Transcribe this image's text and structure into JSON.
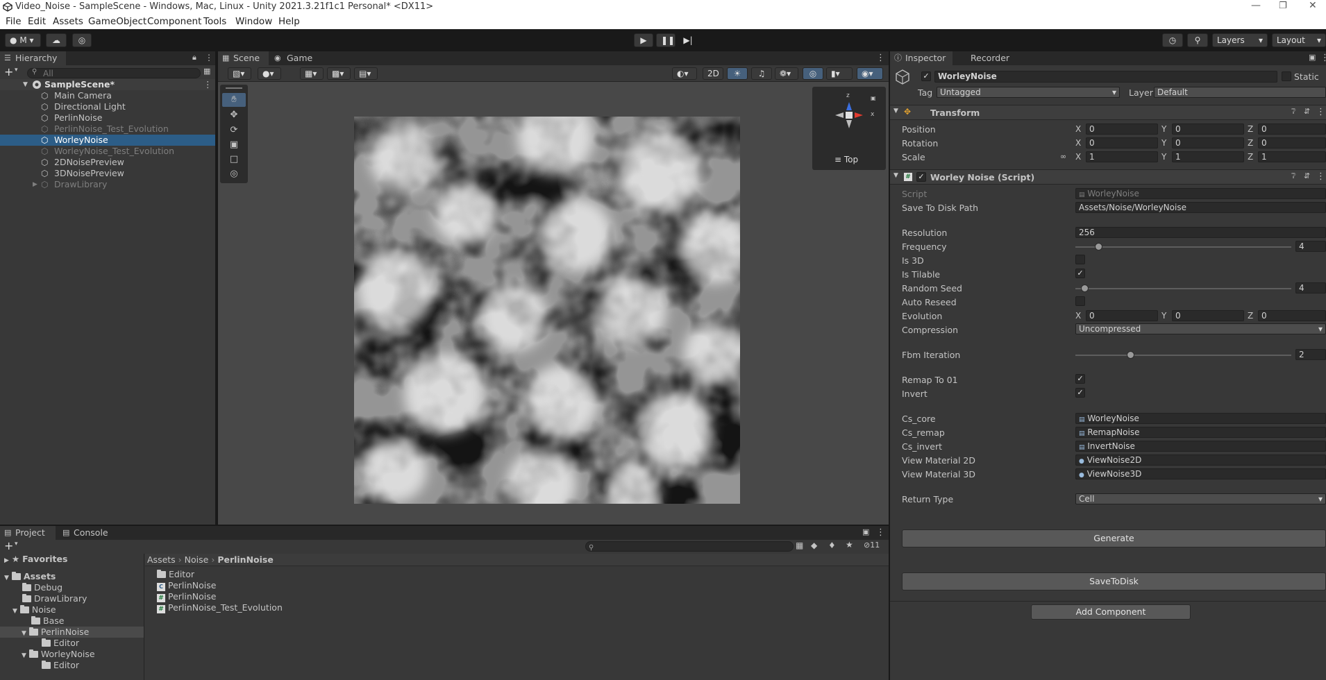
{
  "window": {
    "title": "Video_Noise - SampleScene - Windows, Mac, Linux - Unity 2021.3.21f1c1 Personal* <DX11>"
  },
  "menu": [
    "File",
    "Edit",
    "Assets",
    "GameObject",
    "Component",
    "Tools",
    "Window",
    "Help"
  ],
  "toolbar": {
    "account": "M",
    "layers": "Layers",
    "layout": "Layout"
  },
  "hierarchy": {
    "tab": "Hierarchy",
    "search_placeholder": "All",
    "scene": "SampleScene*",
    "items": [
      {
        "label": "Main Camera"
      },
      {
        "label": "Directional Light"
      },
      {
        "label": "PerlinNoise"
      },
      {
        "label": "PerlinNoise_Test_Evolution"
      },
      {
        "label": "WorleyNoise"
      },
      {
        "label": "WorleyNoise_Test_Evolution"
      },
      {
        "label": "2DNoisePreview"
      },
      {
        "label": "3DNoisePreview"
      },
      {
        "label": "DrawLibrary"
      }
    ]
  },
  "scene": {
    "tabs": [
      "Scene",
      "Game"
    ],
    "mode_2d": "2D",
    "gizmo_view": "Top",
    "axis_x": "x",
    "axis_z": "z"
  },
  "inspector": {
    "tabs": [
      "Inspector",
      "Recorder"
    ],
    "object_name": "WorleyNoise",
    "static": "Static",
    "tag_label": "Tag",
    "tag": "Untagged",
    "layer_label": "Layer",
    "layer": "Default",
    "transform": {
      "title": "Transform",
      "position_label": "Position",
      "rotation_label": "Rotation",
      "scale_label": "Scale",
      "position": [
        "0",
        "0",
        "0"
      ],
      "rotation": [
        "0",
        "0",
        "0"
      ],
      "scale": [
        "1",
        "1",
        "1"
      ]
    },
    "script_comp": {
      "title": "Worley Noise (Script)",
      "script_label": "Script",
      "script": "WorleyNoise",
      "save_path_label": "Save To Disk Path",
      "save_path": "Assets/Noise/WorleyNoise",
      "resolution_label": "Resolution",
      "resolution": "256",
      "frequency_label": "Frequency",
      "frequency": "4",
      "is3d_label": "Is 3D",
      "is_tilable_label": "Is Tilable",
      "random_seed_label": "Random Seed",
      "random_seed": "4",
      "auto_reseed_label": "Auto Reseed",
      "evolution_label": "Evolution",
      "evolution": [
        "0",
        "0",
        "0"
      ],
      "compression_label": "Compression",
      "compression": "Uncompressed",
      "fbm_label": "Fbm Iteration",
      "fbm": "2",
      "remap_label": "Remap To 01",
      "invert_label": "Invert",
      "cs_core_label": "Cs_core",
      "cs_core": "WorleyNoise",
      "cs_remap_label": "Cs_remap",
      "cs_remap": "RemapNoise",
      "cs_invert_label": "Cs_invert",
      "cs_invert": "InvertNoise",
      "vm2d_label": "View Material 2D",
      "vm2d": "ViewNoise2D",
      "vm3d_label": "View Material 3D",
      "vm3d": "ViewNoise3D",
      "return_type_label": "Return Type",
      "return_type": "Cell",
      "generate": "Generate",
      "save_to_disk": "SaveToDisk"
    },
    "add_component": "Add Component"
  },
  "project": {
    "tabs": [
      "Project",
      "Console"
    ],
    "badge": "11",
    "favorites": "Favorites",
    "assets": "Assets",
    "breadcrumb": [
      "Assets",
      "Noise",
      "PerlinNoise"
    ],
    "tree": [
      {
        "label": "Debug"
      },
      {
        "label": "DrawLibrary"
      },
      {
        "label": "Noise"
      },
      {
        "label": "Base"
      },
      {
        "label": "PerlinNoise"
      },
      {
        "label": "Editor"
      },
      {
        "label": "WorleyNoise"
      },
      {
        "label": "Editor"
      }
    ],
    "files": [
      {
        "label": "Editor"
      },
      {
        "label": "PerlinNoise"
      },
      {
        "label": "PerlinNoise"
      },
      {
        "label": "PerlinNoise_Test_Evolution"
      }
    ]
  }
}
